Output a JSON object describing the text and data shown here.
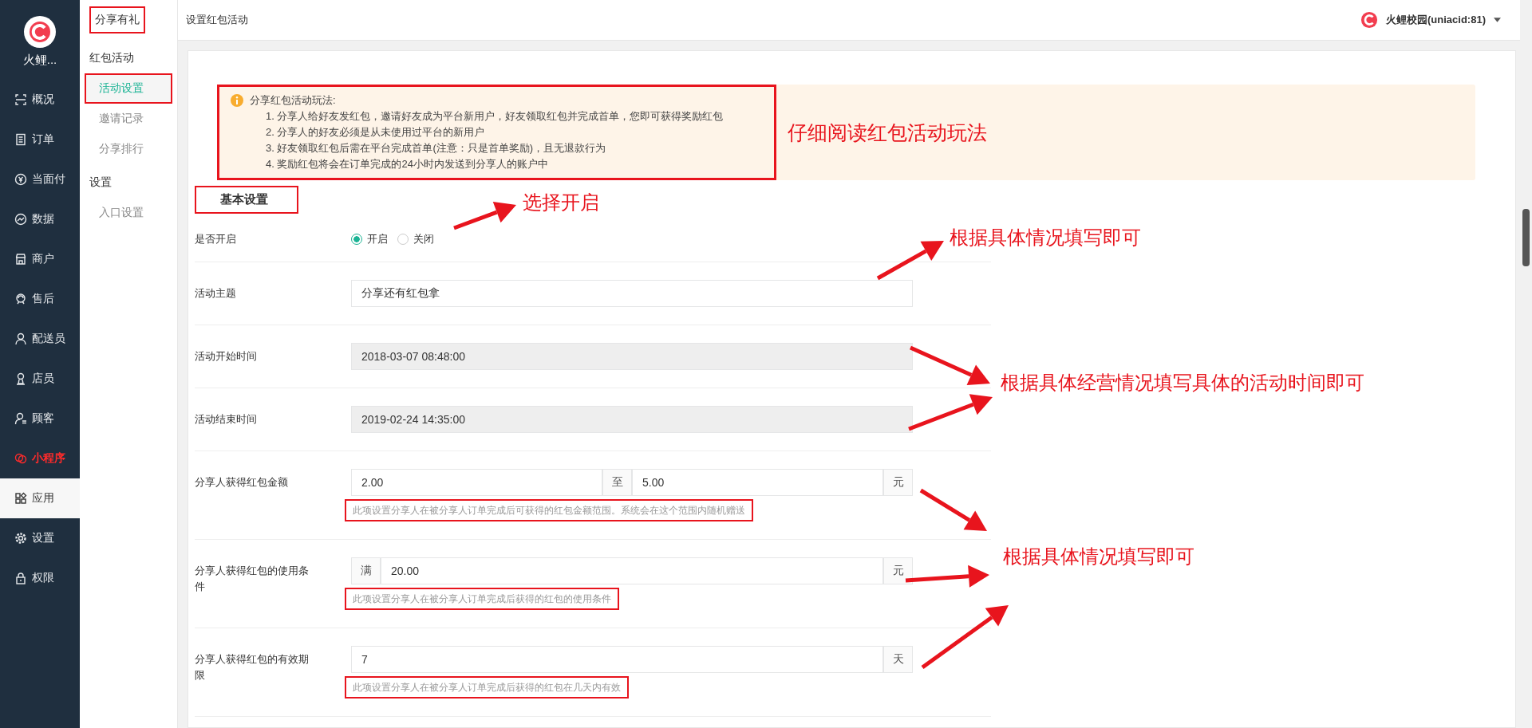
{
  "sidebar": {
    "brand": "火鲤...",
    "items": [
      {
        "label": "概况",
        "selected": false,
        "highlighted": false
      },
      {
        "label": "订单",
        "selected": false,
        "highlighted": false
      },
      {
        "label": "当面付",
        "selected": false,
        "highlighted": false
      },
      {
        "label": "数据",
        "selected": false,
        "highlighted": false
      },
      {
        "label": "商户",
        "selected": false,
        "highlighted": false
      },
      {
        "label": "售后",
        "selected": false,
        "highlighted": false
      },
      {
        "label": "配送员",
        "selected": false,
        "highlighted": false
      },
      {
        "label": "店员",
        "selected": false,
        "highlighted": false
      },
      {
        "label": "顾客",
        "selected": false,
        "highlighted": false
      },
      {
        "label": "小程序",
        "selected": false,
        "highlighted": true
      },
      {
        "label": "应用",
        "selected": true,
        "highlighted": false
      },
      {
        "label": "设置",
        "selected": false,
        "highlighted": false
      },
      {
        "label": "权限",
        "selected": false,
        "highlighted": false
      }
    ]
  },
  "submenu": {
    "title": "分享有礼",
    "title_boxed": true,
    "groups": [
      {
        "title": "红包活动",
        "items": [
          {
            "label": "活动设置",
            "selected": true,
            "boxed": true
          },
          {
            "label": "邀请记录",
            "selected": false,
            "boxed": false
          },
          {
            "label": "分享排行",
            "selected": false,
            "boxed": false
          }
        ]
      },
      {
        "title": "设置",
        "items": [
          {
            "label": "入口设置",
            "selected": false,
            "boxed": false
          }
        ]
      }
    ]
  },
  "header": {
    "breadcrumb": "设置红包活动",
    "account": "火鲤校园(uniacid:81)"
  },
  "notice": {
    "title": "分享红包活动玩法:",
    "boxed": true,
    "lines": [
      "1. 分享人给好友发红包，邀请好友成为平台新用户，好友领取红包并完成首单，您即可获得奖励红包",
      "2. 分享人的好友必须是从未使用过平台的新用户",
      "3. 好友领取红包后需在平台完成首单(注意：只是首单奖励)，且无退款行为",
      "4. 奖励红包将会在订单完成的24小时内发送到分享人的账户中"
    ],
    "callout": "仔细阅读红包活动玩法"
  },
  "section": {
    "title": "基本设置",
    "boxed": true
  },
  "form": [
    {
      "kind": "radio",
      "label": "是否开启",
      "options": [
        {
          "label": "开启",
          "selected": true
        },
        {
          "label": "关闭",
          "selected": false
        }
      ]
    },
    {
      "kind": "text",
      "label": "活动主题",
      "value": "分享还有红包拿",
      "disabled": false
    },
    {
      "kind": "text",
      "label": "活动开始时间",
      "value": "2018-03-07 08:48:00",
      "disabled": true
    },
    {
      "kind": "text",
      "label": "活动结束时间",
      "value": "2019-02-24 14:35:00",
      "disabled": true
    },
    {
      "kind": "range",
      "label": "分享人获得红包金额",
      "from": "2.00",
      "separator": "至",
      "to": "5.00",
      "suffix": "元",
      "hint": "此项设置分享人在被分享人订单完成后可获得的红包金额范围。系统会在这个范围内随机赠送",
      "hint_boxed": true
    },
    {
      "kind": "addon",
      "label": "分享人获得红包的使用条件",
      "prefix": "满",
      "value": "20.00",
      "suffix": "元",
      "hint": "此项设置分享人在被分享人订单完成后获得的红包的使用条件",
      "hint_boxed": true
    },
    {
      "kind": "addon",
      "label": "分享人获得红包的有效期限",
      "value": "7",
      "suffix": "天",
      "hint": "此项设置分享人在被分享人订单完成后获得的红包在几天内有效",
      "hint_boxed": true
    }
  ],
  "annotations": [
    "选择开启",
    "根据具体情况填写即可",
    "根据具体经营情况填写具体的活动时间即可",
    "根据具体情况填写即可"
  ]
}
